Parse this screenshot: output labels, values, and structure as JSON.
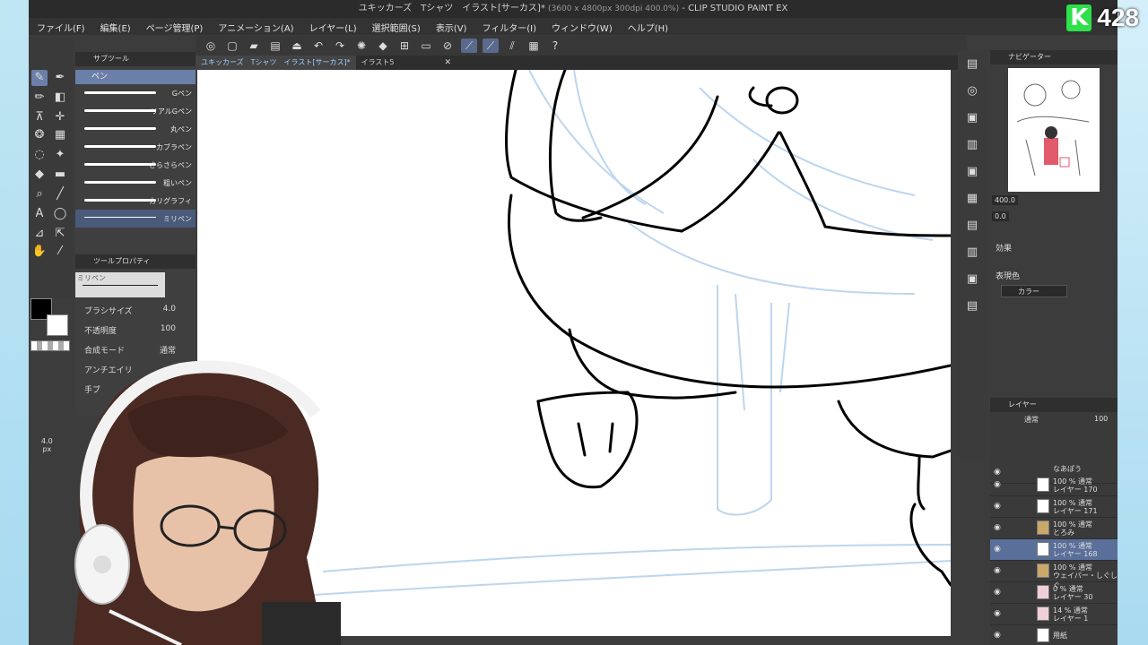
{
  "window": {
    "title": "ユキッカーズ　Tシャツ　イラスト[サーカス]* (3600 x 4800px 300dpi 400.0%) - CLIP STUDIO PAINT EX",
    "title_main": "ユキッカーズ　Tシャツ　イラスト[サーカス]*",
    "title_dim": "(3600 x 4800px 300dpi 400.0%)",
    "title_app": "- CLIP STUDIO PAINT EX"
  },
  "menu": [
    "ファイル(F)",
    "編集(E)",
    "ページ管理(P)",
    "アニメーション(A)",
    "レイヤー(L)",
    "選択範囲(S)",
    "表示(V)",
    "フィルター(I)",
    "ウィンドウ(W)",
    "ヘルプ(H)"
  ],
  "tabs": [
    {
      "label": "ユキッカーズ　Tシャツ　イラスト[サーカス]*",
      "active": true
    },
    {
      "label": "イラスト5",
      "active": false
    }
  ],
  "subtool": {
    "title": "サブツール",
    "group": "ペン",
    "brushes": [
      "Gペン",
      "リアルGペン",
      "丸ペン",
      "カブラペン",
      "さらさらペン",
      "粗いペン",
      "カリグラフィ",
      "ミリペン"
    ]
  },
  "tool_property": {
    "title": "ツールプロパティ",
    "preview_label": "ミリペン",
    "brush_size_label": "ブラシサイズ",
    "brush_size_value": "4.0",
    "opacity_label": "不透明度",
    "opacity_value": "100",
    "blend_label": "合成モード",
    "blend_value": "通常",
    "aa_label": "アンチエイリ",
    "stab_label": "手ブ"
  },
  "size_slider": {
    "value": "4.0",
    "unit": "px"
  },
  "navigator": {
    "title": "ナビゲーター",
    "zoom": "400.0",
    "rotation": "0.0"
  },
  "effect": {
    "title": "効果",
    "color_label": "表現色",
    "color_value": "カラー"
  },
  "layers": {
    "title": "レイヤー",
    "blend": "通常",
    "opacity": "100",
    "items": [
      {
        "line1": "なあぽう",
        "line2": "",
        "selected": false
      },
      {
        "line1": "100 % 通常",
        "line2": "レイヤー 170",
        "selected": false
      },
      {
        "line1": "100 % 通常",
        "line2": "レイヤー 171",
        "selected": false
      },
      {
        "line1": "100 % 通常",
        "line2": "とろみ",
        "selected": false
      },
      {
        "line1": "100 % 通常",
        "line2": "レイヤー 168",
        "selected": true
      },
      {
        "line1": "100 % 通常",
        "line2": "ウェイパー・しぐしぐ",
        "selected": false
      },
      {
        "line1": "0 % 通常",
        "line2": "レイヤー 30",
        "selected": false
      },
      {
        "line1": "14 % 通常",
        "line2": "レイヤー 1",
        "selected": false
      },
      {
        "line1": "用紙",
        "line2": "",
        "selected": false
      }
    ]
  },
  "stream_overlay": {
    "letter": "K",
    "count": "428"
  },
  "colors": {
    "accent": "#6b7fa8",
    "panel": "#3c3c3c",
    "canvas": "#ffffff",
    "logo_green": "#2ee04a"
  }
}
